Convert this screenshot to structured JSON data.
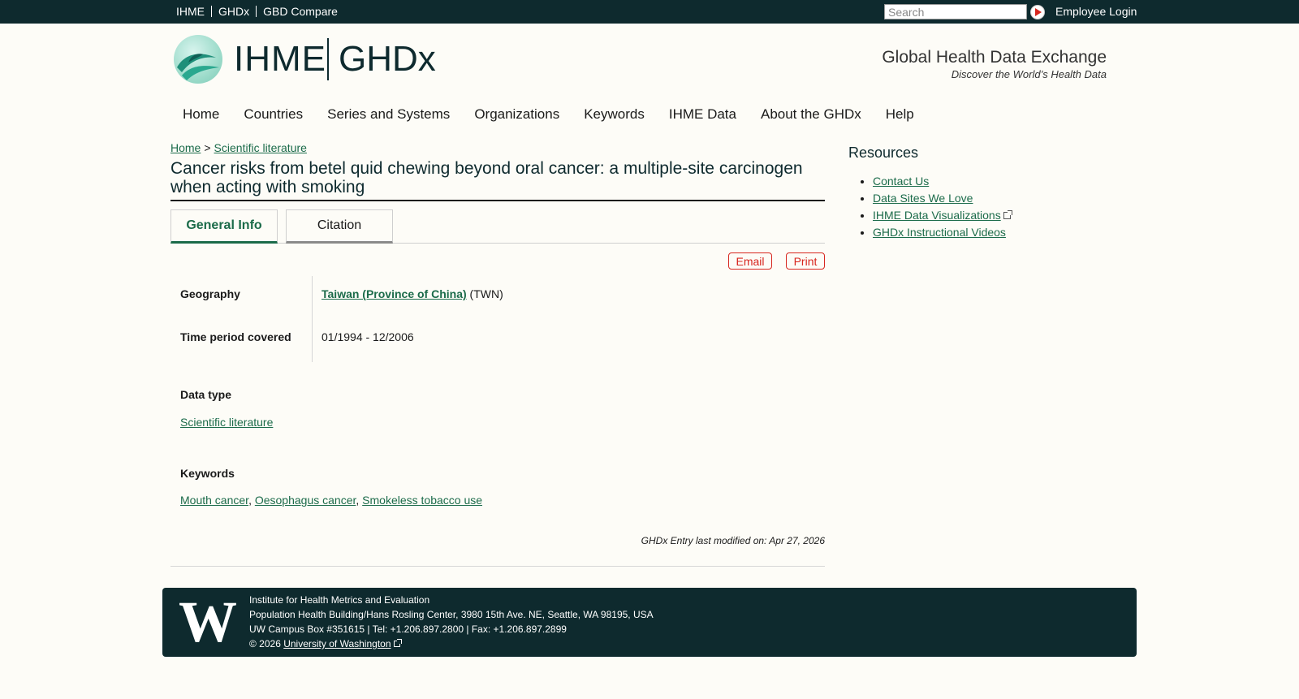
{
  "topbar": {
    "links": [
      "IHME",
      "GHDx",
      "GBD Compare"
    ],
    "search_placeholder": "Search",
    "employee_login": "Employee Login"
  },
  "header": {
    "logo_ihme": "IHME",
    "logo_ghdx": "GHDx",
    "tagline": "Global Health Data Exchange",
    "subtagline": "Discover the World’s Health Data"
  },
  "nav": [
    "Home",
    "Countries",
    "Series and Systems",
    "Organizations",
    "Keywords",
    "IHME Data",
    "About the GHDx",
    "Help"
  ],
  "breadcrumb": {
    "home": "Home",
    "separator": ">",
    "section": "Scientific literature"
  },
  "page_title": "Cancer risks from betel quid chewing beyond oral cancer: a multiple-site carcinogen when acting with smoking",
  "tabs": {
    "general": "General Info",
    "citation": "Citation"
  },
  "actions": {
    "email": "Email",
    "print": "Print"
  },
  "fields": {
    "geography_label": "Geography",
    "geography_link": "Taiwan (Province of China)",
    "geography_code": "(TWN)",
    "time_label": "Time period covered",
    "time_value": "01/1994 - 12/2006",
    "datatype_label": "Data type",
    "datatype_value": "Scientific literature",
    "keywords_label": "Keywords",
    "keywords": [
      "Mouth cancer",
      "Oesophagus cancer",
      "Smokeless tobacco use"
    ]
  },
  "modified": "GHDx Entry last modified on: Apr 27, 2026",
  "sidebar": {
    "title": "Resources",
    "items": [
      "Contact Us",
      "Data Sites We Love",
      "IHME Data Visualizations",
      "GHDx Instructional Videos"
    ]
  },
  "footer": {
    "org": "Institute for Health Metrics and Evaluation",
    "address": "Population Health Building/Hans Rosling Center, 3980 15th Ave. NE, Seattle, WA 98195, USA",
    "contact": "UW Campus Box #351615 | Tel: +1.206.897.2800 | Fax: +1.206.897.2899",
    "copyright": "© 2026",
    "uw_link": "University of Washington",
    "uw_letter": "W"
  },
  "colors": {
    "dark": "#0e2a2e",
    "link": "#1b6b4a",
    "accent": "#d7261e",
    "background": "#fdfcf7"
  }
}
